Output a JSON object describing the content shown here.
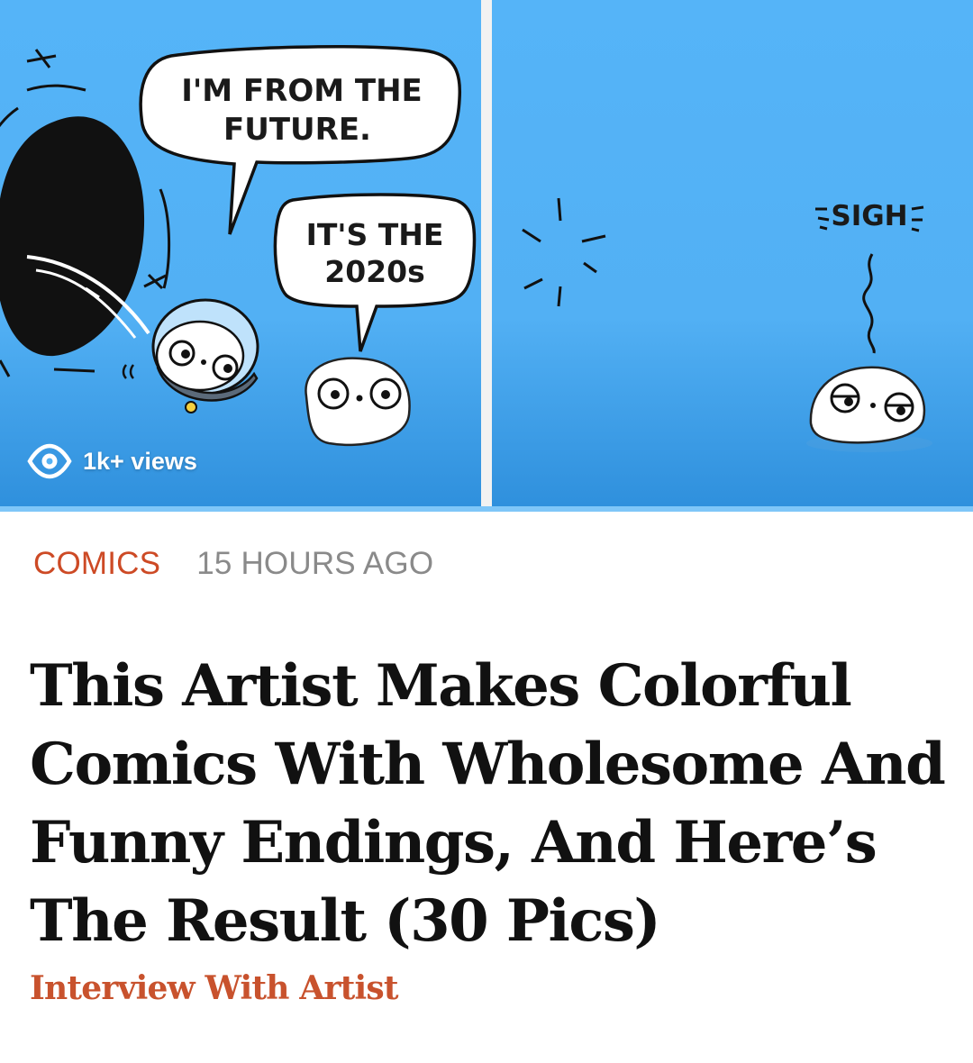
{
  "hero": {
    "views_label": "1k+ views",
    "panel_left": {
      "bubble_1_line_1": "I'M FROM THE",
      "bubble_1_line_2": "FUTURE.",
      "bubble_2_line_1": "IT'S THE",
      "bubble_2_line_2": "2020s"
    },
    "panel_right": {
      "sigh_text": "SIGH"
    },
    "sky_color": "#56b3f5",
    "eye_icon": "eye-icon"
  },
  "meta": {
    "category": "COMICS",
    "timestamp": "15 HOURS AGO"
  },
  "article": {
    "title": "This Artist Makes Colorful Comics With Wholesome And Funny Endings, And Here’s The Result (30 Pics)",
    "subtitle": "Interview With Artist"
  },
  "colors": {
    "accent": "#cd4a25",
    "muted": "#8a8a8a",
    "title": "#111111"
  }
}
